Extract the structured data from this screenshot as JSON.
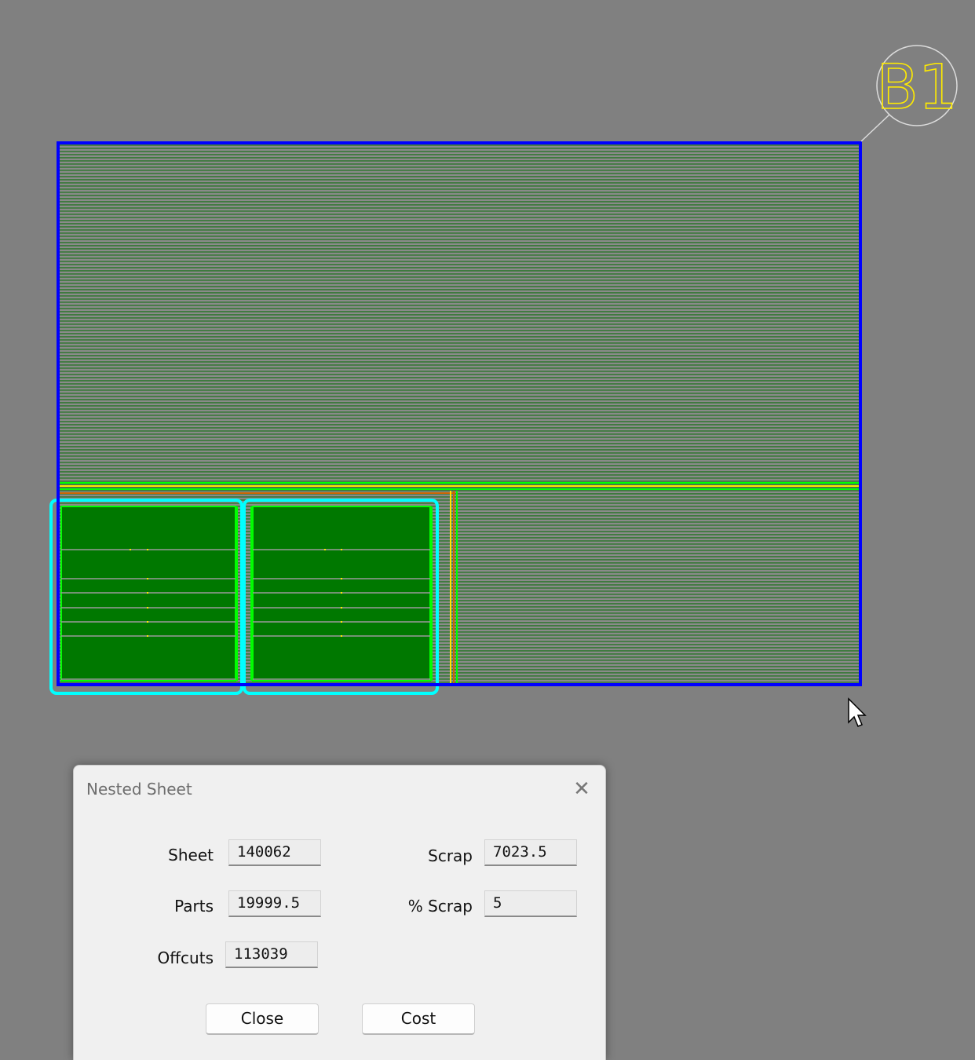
{
  "sheet_label": "B1",
  "colors": {
    "background": "#808080",
    "sheet_border": "#0000ff",
    "sheet_hatch": "#3f7a3f",
    "part_fill": "#007800",
    "part_outline": "#00ffff",
    "cut_line_yellow": "#ffe600",
    "cut_line_green": "#00ff00",
    "label_color": "#ffeb00"
  },
  "dialog": {
    "title": "Nested Sheet",
    "close_icon": "close-icon",
    "fields": {
      "sheet": {
        "label": "Sheet",
        "value": "140062"
      },
      "parts": {
        "label": "Parts",
        "value": "19999.5"
      },
      "offcuts": {
        "label": "Offcuts",
        "value": "113039"
      },
      "scrap": {
        "label": "Scrap",
        "value": "7023.5"
      },
      "pct_scrap": {
        "label": "% Scrap",
        "value": "5"
      }
    },
    "buttons": {
      "close": "Close",
      "cost": "Cost"
    }
  },
  "cursor_icon": "arrow-cursor-icon"
}
